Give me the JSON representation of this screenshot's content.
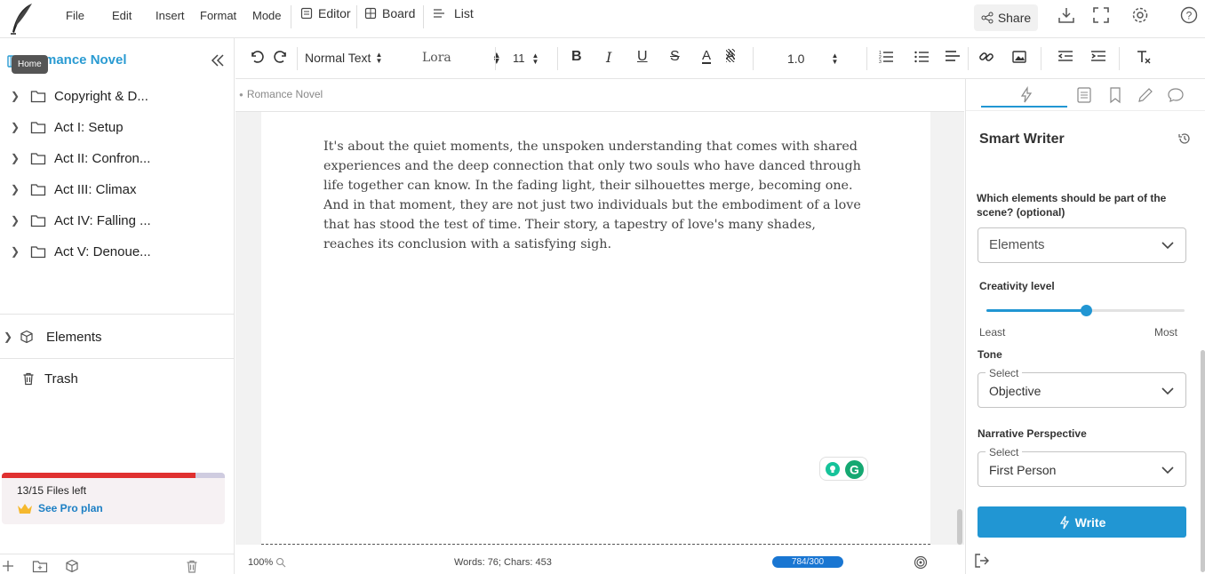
{
  "menu": {
    "file": "File",
    "edit": "Edit",
    "insert": "Insert",
    "format": "Format",
    "mode": "Mode"
  },
  "modes": {
    "editor": "Editor",
    "board": "Board",
    "list": "List"
  },
  "share_label": "Share",
  "sidebar": {
    "tooltip": "Home",
    "project_title": "Romance Novel",
    "items": [
      {
        "label": "Copyright & D..."
      },
      {
        "label": "Act I: Setup"
      },
      {
        "label": "Act II: Confron..."
      },
      {
        "label": "Act III: Climax"
      },
      {
        "label": "Act IV: Falling ..."
      },
      {
        "label": "Act V: Denoue..."
      }
    ],
    "elements_label": "Elements",
    "trash_label": "Trash",
    "files_left": "13/15 Files left",
    "files_fraction": 0.867,
    "pro_plan": "See Pro plan"
  },
  "toolbar": {
    "style": "Normal Text",
    "font": "Lora",
    "size": "11",
    "line_spacing": "1.0"
  },
  "editor": {
    "breadcrumb": "Romance Novel",
    "text": "It's about the quiet moments, the unspoken understanding that comes with shared experiences and the deep connection that only two souls who have danced through life together can know. In the fading light, their silhouettes merge, becoming one. And in that moment, they are not just two individuals but the embodiment of a love that has stood the test of time. Their story, a tapestry of love's many shades, reaches its conclusion with a satisfying sigh."
  },
  "status": {
    "zoom": "100%",
    "counts": "Words: 76; Chars: 453",
    "progress": "784/300"
  },
  "panel": {
    "title": "Smart Writer",
    "elements_question": "Which elements should be part of the scene? (optional)",
    "elements_value": "Elements",
    "creativity_label": "Creativity level",
    "creativity_value": 0.5,
    "least": "Least",
    "most": "Most",
    "tone_label": "Tone",
    "tone_caption": "Select",
    "tone_value": "Objective",
    "perspective_label": "Narrative Perspective",
    "perspective_caption": "Select",
    "perspective_value": "First Person",
    "write_label": "Write"
  },
  "colors": {
    "accent": "#2196d3",
    "danger": "#e03030",
    "progress": "#1976d2"
  }
}
